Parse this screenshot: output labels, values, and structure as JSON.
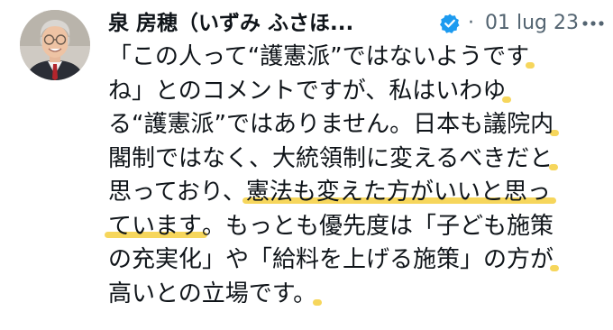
{
  "tweet": {
    "author_name": "泉 房穂（いずみ ふさほ...",
    "separator": "·",
    "date": "01 lug 23",
    "lines": [
      {
        "before": "「この人って“護憲派”ではないようです",
        "highlight": "",
        "after": ""
      },
      {
        "before": "ね」とのコメントですが、私はいわゆ",
        "highlight": "",
        "after": ""
      },
      {
        "before": "る“護憲派”ではありません。日本も議院内",
        "highlight": "",
        "after": ""
      },
      {
        "before": "閣制ではなく、大統領制に変えるべきだと",
        "highlight": "",
        "after": ""
      },
      {
        "before": "思っており、",
        "highlight": "憲法も変えた方がいいと思っ",
        "after": ""
      },
      {
        "before": "",
        "highlight": "ています",
        "after": "。もっとも優先度は「子ども施策"
      },
      {
        "before": "の充実化」や「給料を上げる施策」の方が",
        "highlight": "",
        "after": ""
      },
      {
        "before": "高いとの立場です。",
        "highlight": "",
        "after": ""
      }
    ]
  },
  "colors": {
    "text": "#0f1419",
    "secondary": "#536471",
    "verified": "#1d9bf0",
    "highlight": "#f5d14a"
  },
  "icons": {
    "verified": "verified-badge-icon",
    "more": "more-options-icon"
  }
}
